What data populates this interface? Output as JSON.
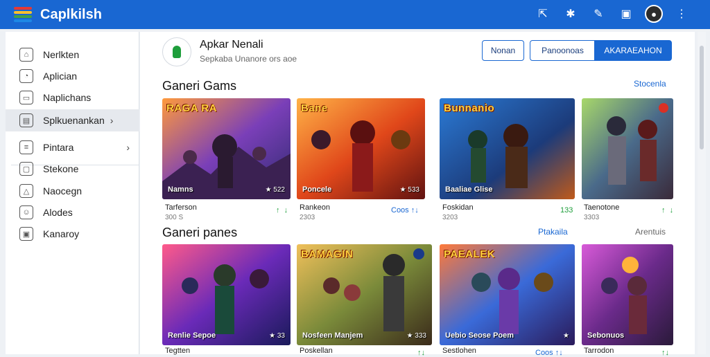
{
  "colors": {
    "primary": "#1967d2",
    "logo": [
      "#e53935",
      "#fbc02d",
      "#43a047",
      "#1e88e5"
    ]
  },
  "topbar": {
    "brand": "Caplkilsh",
    "icons": [
      {
        "name": "share-icon",
        "glyph": "⇱"
      },
      {
        "name": "puzzle-icon",
        "glyph": "✱"
      },
      {
        "name": "edit-icon",
        "glyph": "✎"
      },
      {
        "name": "notification-icon",
        "glyph": "▣"
      }
    ]
  },
  "sidebar": {
    "items": [
      {
        "label": "Nerlkten",
        "icon": "home-icon",
        "glyph": "⌂",
        "chev": ""
      },
      {
        "label": "Aplician",
        "icon": "chat-icon",
        "glyph": "◔",
        "chev": ""
      },
      {
        "label": "Naplichans",
        "icon": "message-icon",
        "glyph": "▭",
        "chev": ""
      },
      {
        "label": "Splkuenankan",
        "icon": "calendar-icon",
        "glyph": "▤",
        "chev": "›"
      },
      {
        "label": "Pintara",
        "icon": "list-icon",
        "glyph": "≡",
        "chev": "›"
      },
      {
        "label": "Stekone",
        "icon": "window-icon",
        "glyph": "▢",
        "chev": ""
      },
      {
        "label": "Naocegn",
        "icon": "triangle-icon",
        "glyph": "△",
        "chev": ""
      },
      {
        "label": "Alodes",
        "icon": "smile-icon",
        "glyph": "☺",
        "chev": ""
      },
      {
        "label": "Kanaroy",
        "icon": "box-icon",
        "glyph": "▣",
        "chev": ""
      }
    ]
  },
  "header": {
    "app_name": "Apkar Nenali",
    "app_sub": "Sepkaba Unanore ors aoe",
    "btn_1": "Nonan",
    "btn_2": "Panoonoas",
    "btn_3": "AKARAEAHON"
  },
  "section_1": {
    "title": "Ganeri Gams",
    "link": "Stocenla",
    "cards": [
      {
        "title": "RAGA RA",
        "caption": "Namns",
        "rating": "★ 522",
        "name": "Tarferson",
        "sub": "300 S",
        "right": "↑  ↓",
        "right_color": "green"
      },
      {
        "title": "Bane",
        "caption": "Poncele",
        "rating": "★ 533",
        "name": "Rankeon",
        "sub": "2303",
        "right": "Coos ↑↓",
        "right_color": "blue"
      },
      {
        "title": "Bunnanio",
        "caption": "Baaliae Glise",
        "rating": "",
        "name": "Foskidan",
        "sub": "3203",
        "right": "133",
        "right_color": "green"
      },
      {
        "title": "",
        "caption": "",
        "rating": "",
        "name": "Taenotone",
        "sub": "3303",
        "right": "↑  ↓",
        "right_color": "green"
      }
    ]
  },
  "section_2": {
    "title": "Ganeri panes",
    "link": "Ptakaila",
    "link_right": "Arentuis",
    "cards": [
      {
        "title": "",
        "caption": "Renlie Sepoe",
        "rating": "★ 33",
        "name": "Tegtten",
        "sub": "",
        "right": "",
        "right_color": "green"
      },
      {
        "title": "BAMAGIN",
        "caption": "Nosfeen Manjem",
        "rating": "★ 333",
        "name": "Poskellan",
        "sub": "",
        "right": "↑↓",
        "right_color": "green"
      },
      {
        "title": "PAEALEK",
        "caption": "Uebio Seose Poem",
        "rating": "★",
        "name": "Sestlohen",
        "sub": "",
        "right": "Coos ↑↓",
        "right_color": "blue"
      },
      {
        "title": "",
        "caption": "Sebonuos",
        "rating": "",
        "name": "Tarrodon",
        "sub": "",
        "right": "↑↓",
        "right_color": "green"
      }
    ]
  }
}
